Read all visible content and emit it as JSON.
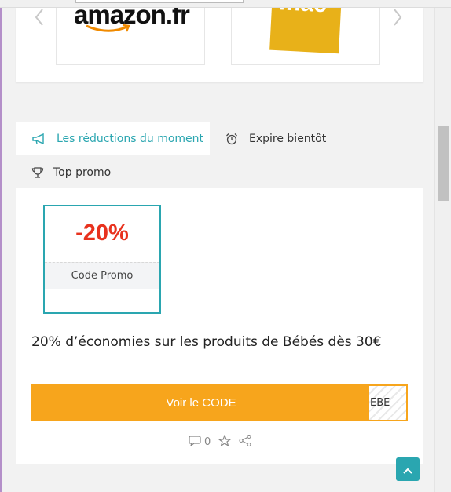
{
  "stores": {
    "prev_icon": "chevron-left-icon",
    "next_icon": "chevron-right-icon",
    "items": [
      {
        "logo_text": "amazon.fr",
        "brand_color": "#111111"
      },
      {
        "logo_text": "fnac",
        "brand_color": "#e8b119"
      }
    ]
  },
  "tabs": [
    {
      "label": "Les réductions du moment",
      "icon": "megaphone-icon",
      "active": true
    },
    {
      "label": "Expire bientôt",
      "icon": "alarm-clock-icon",
      "active": false
    },
    {
      "label": "Top promo",
      "icon": "trophy-icon",
      "active": false
    }
  ],
  "offer": {
    "discount": "-20%",
    "type": "Code Promo",
    "title": "20% d’économies sur les produits de Bébés dès 30€",
    "button_label": "Voir le CODE",
    "code_peek": "EBE",
    "comments_count": "0",
    "comment_icon": "comment-icon",
    "favorite_icon": "star-icon",
    "share_icon": "share-icon"
  },
  "colors": {
    "accent": "#2aa6b0",
    "discount": "#e8321e",
    "button": "#f7a51c"
  },
  "back_to_top_icon": "chevron-up-icon"
}
